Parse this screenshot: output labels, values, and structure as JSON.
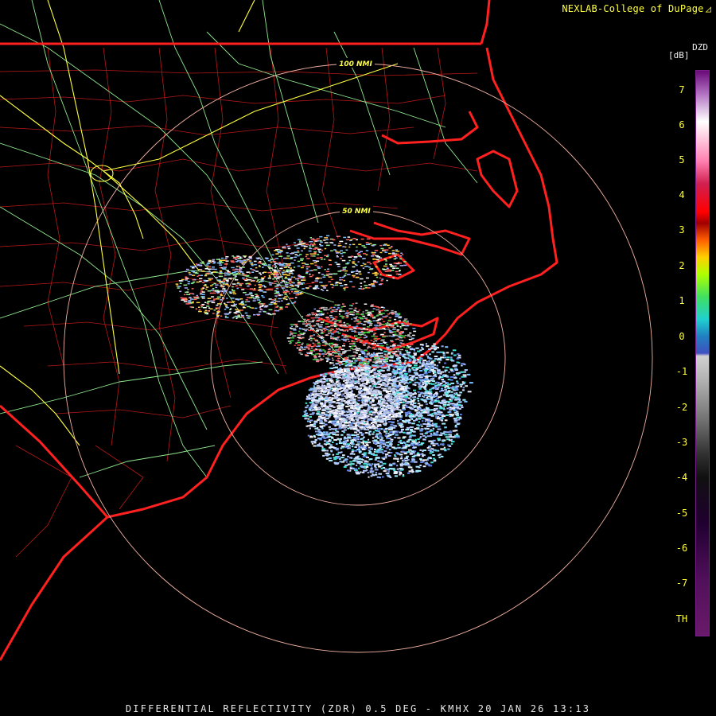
{
  "header": {
    "brand": "NEXLAB-College of DuPage",
    "logo_icon": "cod-logo-icon"
  },
  "footer": {
    "caption": "DIFFERENTIAL REFLECTIVITY (ZDR) 0.5 DEG - KMHX 20 JAN 26 13:13"
  },
  "range_rings": [
    "50 NMI",
    "100 NMI"
  ],
  "colorbar": {
    "product": "DZD",
    "unit": "[dB]",
    "ticks": [
      "7",
      "6",
      "5",
      "4",
      "3",
      "2",
      "1",
      "0",
      "-1",
      "-2",
      "-3",
      "-4",
      "-5",
      "-6",
      "-7",
      "TH"
    ]
  },
  "colors": {
    "background": "#000000",
    "state_borders": "#ff2020",
    "county_lines": "#c01818",
    "highways": "#90ee90",
    "interstates": "#ffff40",
    "range_rings": "#f0b0a0",
    "label_text": "#ffff40"
  }
}
